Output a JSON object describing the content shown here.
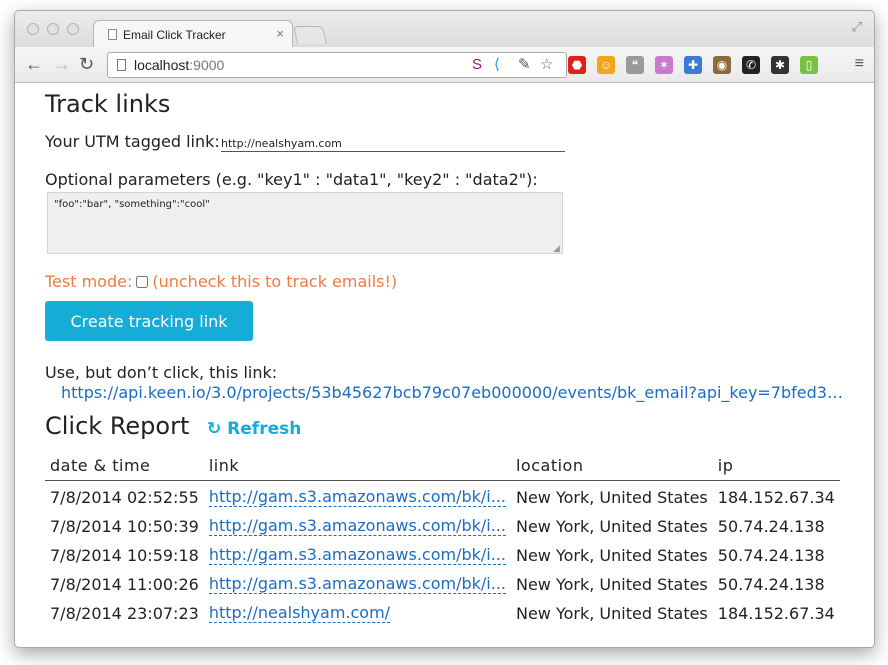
{
  "browser": {
    "tab_title": "Email Click Tracker",
    "tab_close": "×",
    "url_host": "localhost",
    "url_port": ":9000",
    "nav": {
      "back": "←",
      "forward": "→",
      "reload": "↻"
    },
    "omnibox_extensions": [
      {
        "icon": "s-extension-icon",
        "glyph": "S",
        "color": "#8b1a8b"
      },
      {
        "icon": "share-icon",
        "glyph": "⟨",
        "color": "#1ba1e2"
      },
      {
        "icon": "pen-icon",
        "glyph": "✎",
        "color": "#555555"
      },
      {
        "icon": "bookmark-star-icon",
        "glyph": "☆",
        "color": "#666666"
      }
    ],
    "extensions": [
      {
        "icon": "adblock-icon",
        "glyph": "⬣",
        "color": "#e0211b"
      },
      {
        "icon": "face-extension-icon",
        "glyph": "☺",
        "color": "#f3a61b"
      },
      {
        "icon": "speech-bubble-icon",
        "glyph": "❝",
        "color": "#9a9a9a"
      },
      {
        "icon": "bird-extension-icon",
        "glyph": "✶",
        "color": "#c97ac8"
      },
      {
        "icon": "pinwheel-icon",
        "glyph": "✚",
        "color": "#3a7bd5"
      },
      {
        "icon": "owl-extension-icon",
        "glyph": "◉",
        "color": "#8b6b3d"
      },
      {
        "icon": "phone-icon",
        "glyph": "✆",
        "color": "#222222"
      },
      {
        "icon": "asterisk-icon",
        "glyph": "✱",
        "color": "#333333"
      },
      {
        "icon": "notes-icon",
        "glyph": "▯",
        "color": "#7ac142"
      }
    ],
    "menu_glyph": "≡"
  },
  "page": {
    "heading": "Track links",
    "utm_label": "Your UTM tagged link:",
    "utm_value": "http://nealshyam.com",
    "optional_label": "Optional parameters (e.g. \"key1\" : \"data1\", \"key2\" : \"data2\"):",
    "optional_value": "\"foo\":\"bar\", \"something\":\"cool\"",
    "test_mode_label": "Test mode:",
    "test_mode_note": "(uncheck this to track emails!)",
    "create_button": "Create tracking link",
    "use_label": "Use, but don’t click, this link:",
    "tracking_link": "https://api.keen.io/3.0/projects/53b45627bcb79c07eb000000/events/bk_email?api_key=7bfed3b...",
    "report_title": "Click Report",
    "refresh_label": "Refresh",
    "refresh_glyph": "↻",
    "table": {
      "headers": [
        "date & time",
        "link",
        "location",
        "ip"
      ],
      "rows": [
        {
          "datetime": "7/8/2014 02:52:55",
          "link": "http://gam.s3.amazonaws.com/bk/i...",
          "location": "New York, United States",
          "ip": "184.152.67.34"
        },
        {
          "datetime": "7/8/2014 10:50:39",
          "link": "http://gam.s3.amazonaws.com/bk/i...",
          "location": "New York, United States",
          "ip": "50.74.24.138"
        },
        {
          "datetime": "7/8/2014 10:59:18",
          "link": "http://gam.s3.amazonaws.com/bk/i...",
          "location": "New York, United States",
          "ip": "50.74.24.138"
        },
        {
          "datetime": "7/8/2014 11:00:26",
          "link": "http://gam.s3.amazonaws.com/bk/i...",
          "location": "New York, United States",
          "ip": "50.74.24.138"
        },
        {
          "datetime": "7/8/2014 23:07:23",
          "link": "http://nealshyam.com/",
          "location": "New York, United States",
          "ip": "184.152.67.34"
        }
      ]
    }
  }
}
